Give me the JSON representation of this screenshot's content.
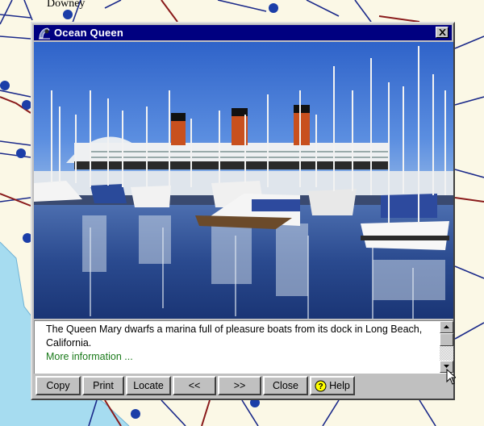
{
  "map": {
    "labels": [
      "Downey"
    ]
  },
  "window": {
    "title": "Ocean Queen",
    "close_glyph": "✕",
    "caption": "The Queen Mary dwarfs a marina full of pleasure boats from its dock in Long Beach, California.",
    "more_info": "More information ...",
    "buttons": {
      "copy": "Copy",
      "print": "Print",
      "locate": "Locate",
      "prev": "<<",
      "next": ">>",
      "close": "Close",
      "help": "Help"
    }
  },
  "colors": {
    "titlebar": "#000080",
    "more_info_link": "#1a7a1a",
    "map_background": "#fbf8e6"
  }
}
